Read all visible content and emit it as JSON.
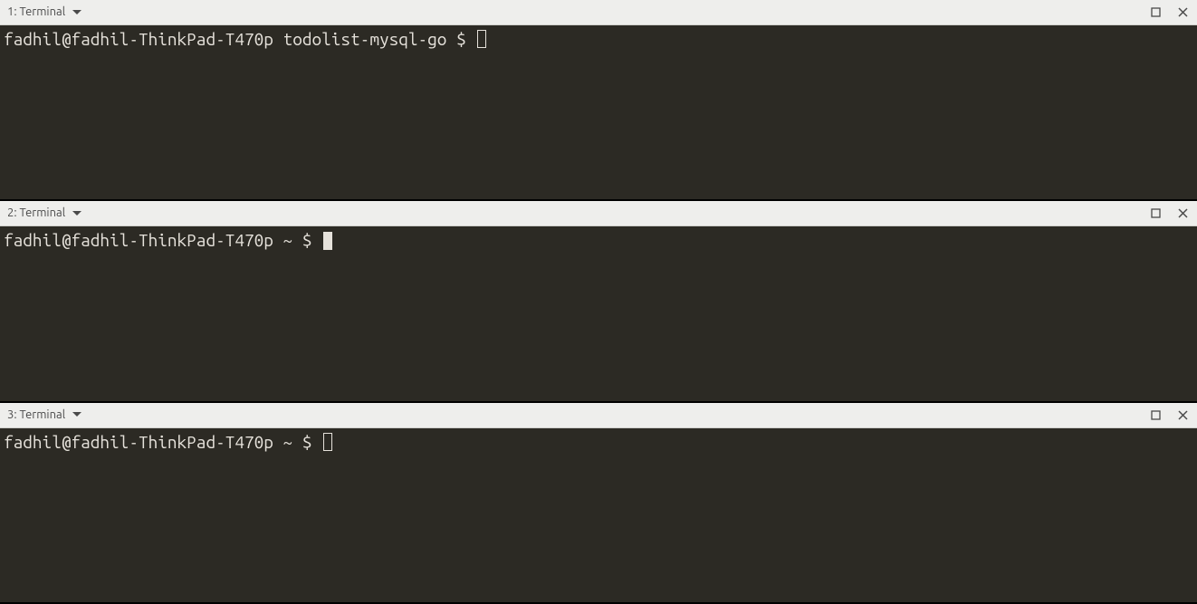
{
  "panes": [
    {
      "index": 0,
      "title": "1: Terminal",
      "prompt": "fadhil@fadhil-ThinkPad-T470p todolist-mysql-go $ ",
      "cursor_filled": false
    },
    {
      "index": 1,
      "title": "2: Terminal",
      "prompt": "fadhil@fadhil-ThinkPad-T470p ~ $ ",
      "cursor_filled": true
    },
    {
      "index": 2,
      "title": "3: Terminal",
      "prompt": "fadhil@fadhil-ThinkPad-T470p ~ $ ",
      "cursor_filled": false
    }
  ],
  "icons": {
    "dropdown": "chevron-down",
    "maximize": "maximize",
    "close": "close"
  }
}
